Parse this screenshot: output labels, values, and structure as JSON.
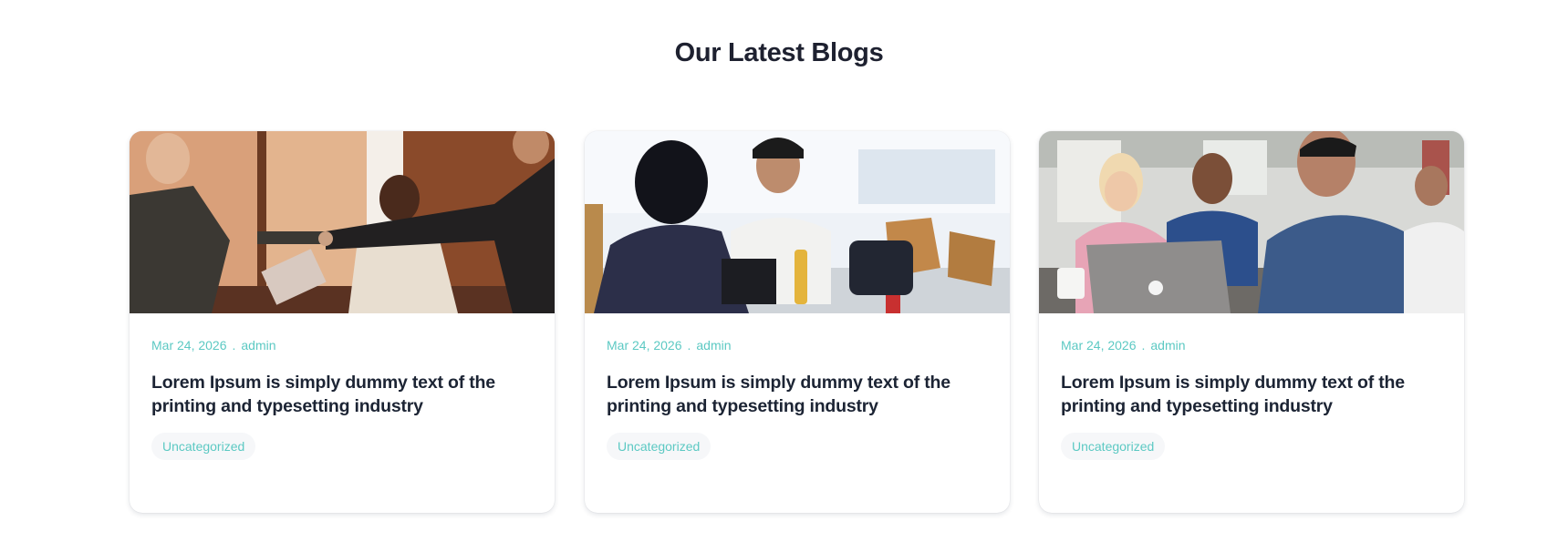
{
  "section": {
    "title": "Our Latest Blogs"
  },
  "posts": [
    {
      "date": "Mar 24, 2026",
      "separator": ".",
      "author": "admin",
      "title": "Lorem Ipsum is simply dummy text of the printing and typesetting industry",
      "category": "Uncategorized",
      "image": "team-fist-bump-photo"
    },
    {
      "date": "Mar 24, 2026",
      "separator": ".",
      "author": "admin",
      "title": "Lorem Ipsum is simply dummy text of the printing and typesetting industry",
      "category": "Uncategorized",
      "image": "people-working-on-laptops-photo"
    },
    {
      "date": "Mar 24, 2026",
      "separator": ".",
      "author": "admin",
      "title": "Lorem Ipsum is simply dummy text of the printing and typesetting industry",
      "category": "Uncategorized",
      "image": "office-meeting-photo"
    }
  ],
  "colors": {
    "accent": "#5cc9c3",
    "heading": "#1e2130",
    "tag_background": "#f6f7f9"
  }
}
